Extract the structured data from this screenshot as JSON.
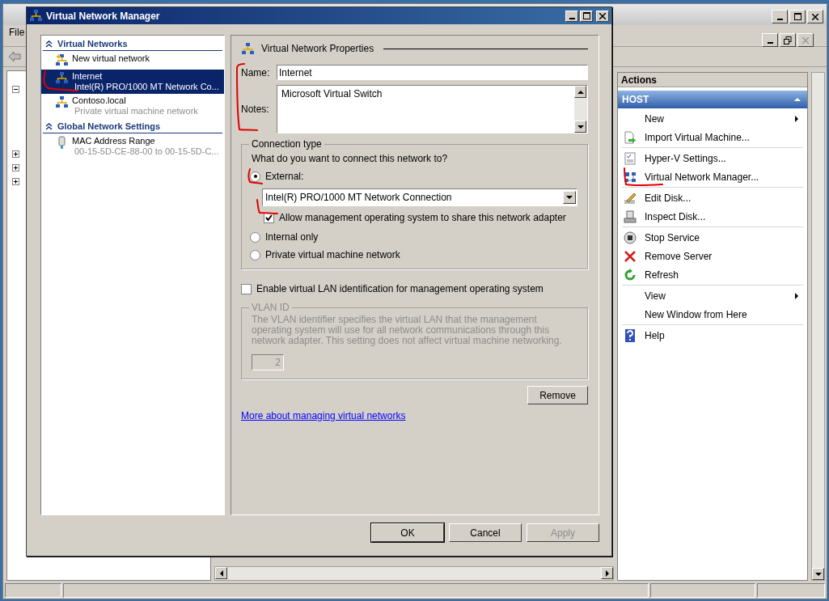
{
  "main_window": {
    "menu": [
      "File"
    ],
    "tree_expanders": [
      {
        "expanded": true
      },
      {
        "expanded": false
      },
      {
        "expanded": false
      },
      {
        "expanded": false
      }
    ],
    "actions": {
      "title": "Actions",
      "section": "HOST",
      "groups": [
        [
          {
            "label": "New",
            "kind": "plain",
            "submenu": true
          },
          {
            "label": "Import Virtual Machine...",
            "kind": "import",
            "submenu": false
          }
        ],
        [
          {
            "label": "Hyper-V Settings...",
            "kind": "settings",
            "submenu": false
          },
          {
            "label": "Virtual Network Manager...",
            "kind": "network",
            "submenu": false
          }
        ],
        [
          {
            "label": "Edit Disk...",
            "kind": "edit",
            "submenu": false
          },
          {
            "label": "Inspect Disk...",
            "kind": "inspect",
            "submenu": false
          }
        ],
        [
          {
            "label": "Stop Service",
            "kind": "stop",
            "submenu": false
          },
          {
            "label": "Remove Server",
            "kind": "remove",
            "submenu": false
          },
          {
            "label": "Refresh",
            "kind": "refresh",
            "submenu": false
          }
        ],
        [
          {
            "label": "View",
            "kind": "plain",
            "submenu": true
          },
          {
            "label": "New Window from Here",
            "kind": "plain",
            "submenu": false
          }
        ],
        [
          {
            "label": "Help",
            "kind": "help",
            "submenu": false
          }
        ]
      ]
    }
  },
  "dialog": {
    "title": "Virtual Network Manager",
    "sections": [
      {
        "title": "Virtual Networks",
        "items": [
          {
            "kind": "new",
            "label": "New virtual network",
            "selected": false
          },
          {
            "kind": "network",
            "label": "Internet",
            "detail": "Intel(R) PRO/1000 MT Network Co...",
            "selected": true
          },
          {
            "kind": "network",
            "label": "Contoso.local",
            "detail": "Private virtual machine network",
            "selected": false
          }
        ]
      },
      {
        "title": "Global Network Settings",
        "items": [
          {
            "kind": "mac",
            "label": "MAC Address Range",
            "detail": "00-15-5D-CE-88-00 to 00-15-5D-C...",
            "selected": false
          }
        ]
      }
    ],
    "properties": {
      "heading": "Virtual Network Properties",
      "name": {
        "label": "Name:",
        "value": "Internet"
      },
      "notes": {
        "label": "Notes:",
        "value": "Microsoft Virtual Switch"
      },
      "connection": {
        "title": "Connection type",
        "question": "What do you want to connect this network to?",
        "options": [
          {
            "label": "External:",
            "selected": true
          },
          {
            "label": "Internal only",
            "selected": false
          },
          {
            "label": "Private virtual machine network",
            "selected": false
          }
        ],
        "adapter": "Intel(R) PRO/1000 MT Network Connection",
        "share": {
          "label": "Allow management operating system to share this network adapter",
          "checked": true
        }
      },
      "vlan_enable": {
        "label": "Enable virtual LAN identification for management operating system",
        "checked": false
      },
      "vlan_id": {
        "title": "VLAN ID",
        "description": "The VLAN identifier specifies the virtual LAN that the management operating system will use for all network communications through this network adapter. This setting does not affect virtual machine networking.",
        "value": "2",
        "disabled": true
      },
      "remove": "Remove",
      "link": "More about managing virtual networks"
    },
    "buttons": [
      {
        "label": "OK",
        "disabled": false
      },
      {
        "label": "Cancel",
        "disabled": false
      },
      {
        "label": "Apply",
        "disabled": true
      }
    ]
  }
}
